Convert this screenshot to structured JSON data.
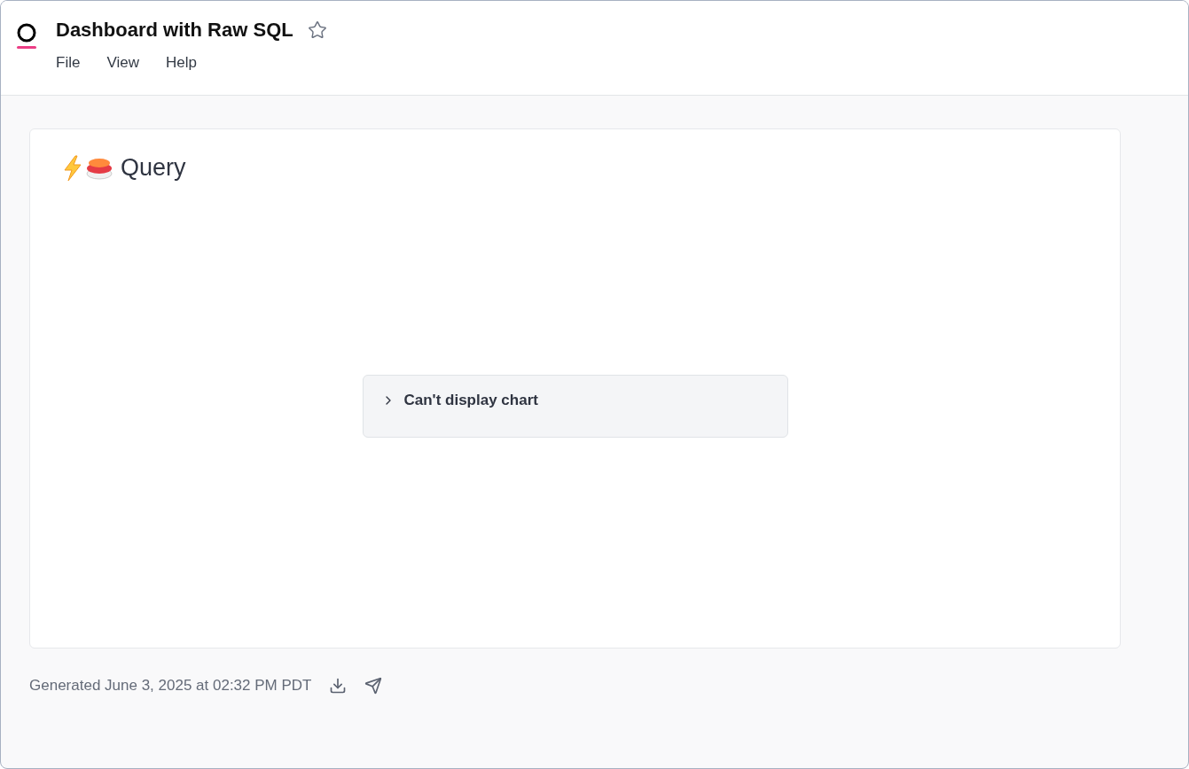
{
  "header": {
    "title": "Dashboard with Raw SQL",
    "starred": false,
    "menu": [
      "File",
      "View",
      "Help"
    ]
  },
  "card": {
    "title": "Query",
    "notice": {
      "label": "Can't display chart",
      "expanded": false
    }
  },
  "footer": {
    "generated": "Generated June 3, 2025 at 02:32 PM PDT"
  }
}
